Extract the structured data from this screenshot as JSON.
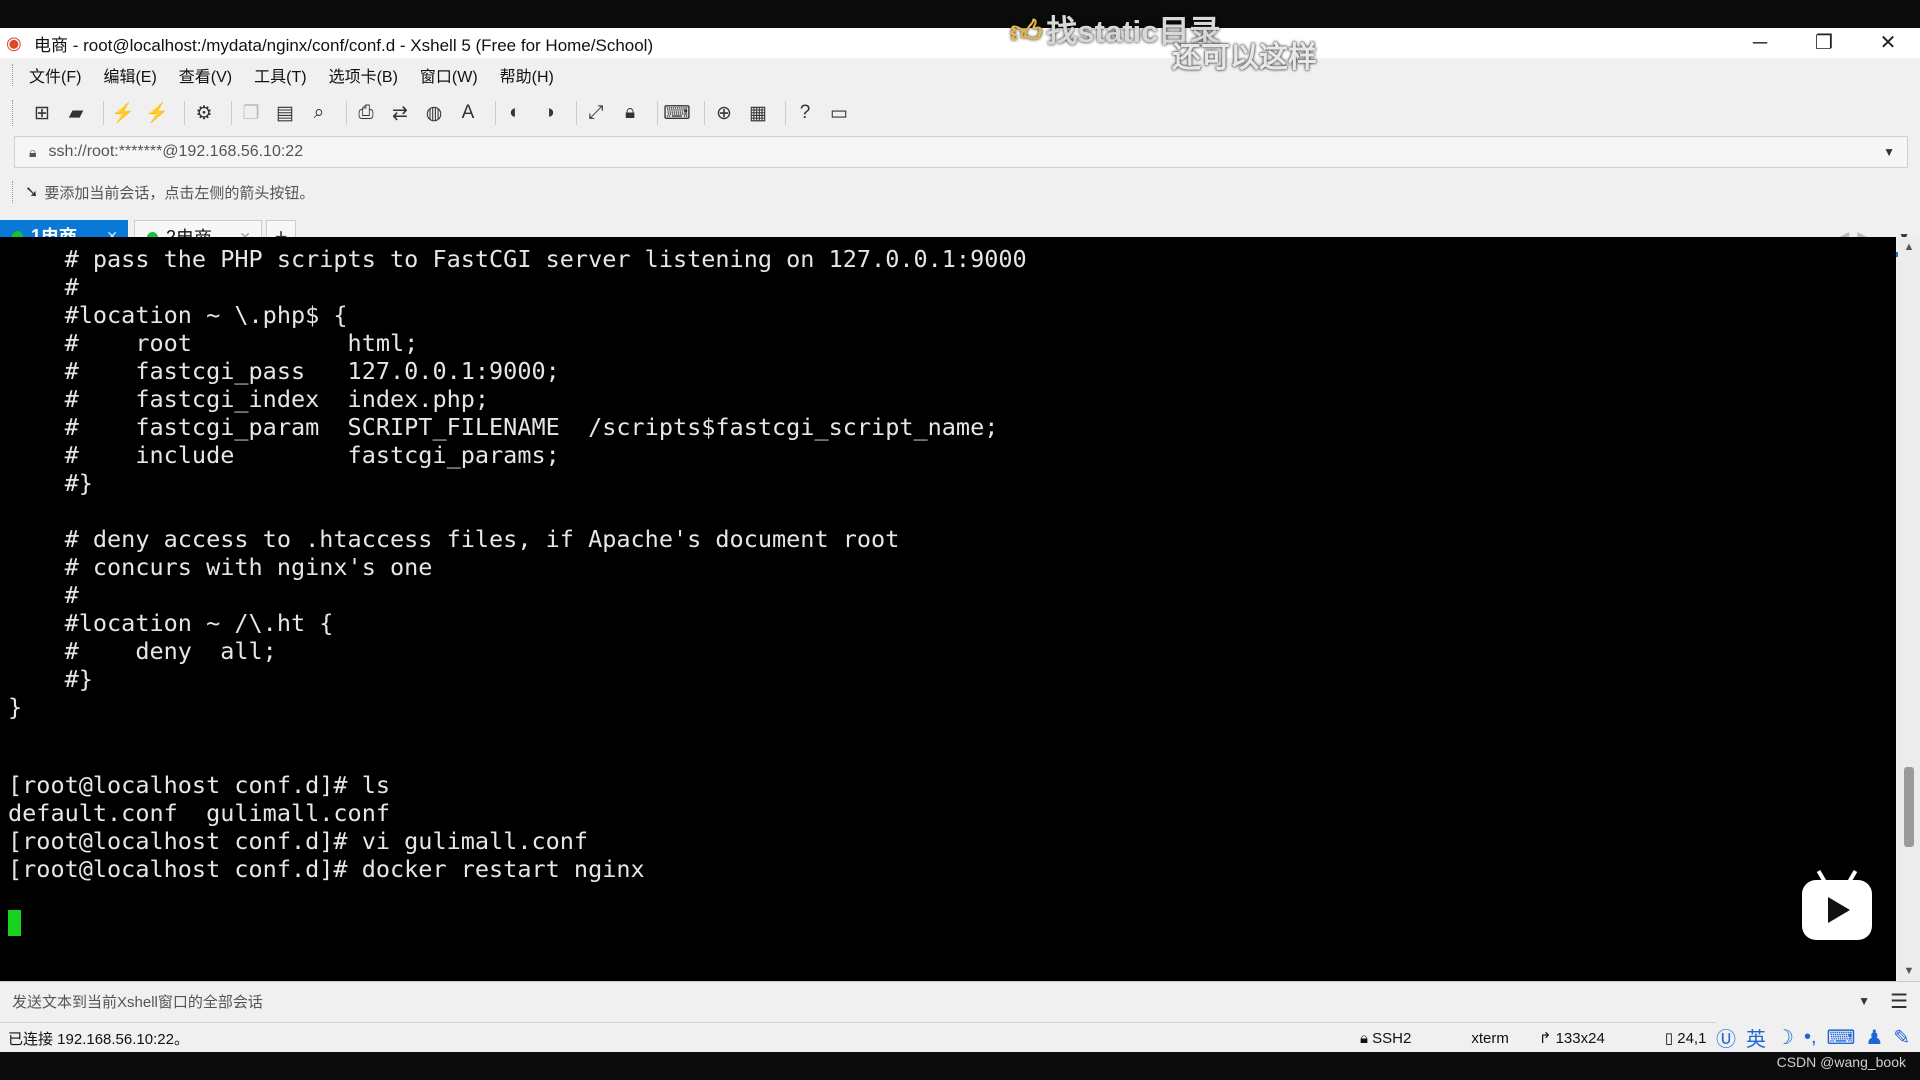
{
  "video_overlay": {
    "thumb_icon": "thumbs-up",
    "top_text": "找static目录",
    "sub_text": "还可以这样"
  },
  "window": {
    "title": "电商 - root@localhost:/mydata/nginx/conf/conf.d - Xshell 5 (Free for Home/School)",
    "minimize": "─",
    "maximize": "❐",
    "close": "✕"
  },
  "menu": [
    "文件(F)",
    "编辑(E)",
    "查看(V)",
    "工具(T)",
    "选项卡(B)",
    "窗口(W)",
    "帮助(H)"
  ],
  "address": {
    "value": "ssh://root:*******@192.168.56.10:22"
  },
  "hint": {
    "text": "要添加当前会话，点击左侧的箭头按钮。"
  },
  "tabs": [
    {
      "number": "1",
      "label": "电商",
      "active": true,
      "status_color": "#19c137"
    },
    {
      "number": "2",
      "label": "电商",
      "active": false,
      "status_color": "#19c137"
    }
  ],
  "terminal": {
    "lines": [
      "    # pass the PHP scripts to FastCGI server listening on 127.0.0.1:9000",
      "    #",
      "    #location ~ \\.php$ {",
      "    #    root           html;",
      "    #    fastcgi_pass   127.0.0.1:9000;",
      "    #    fastcgi_index  index.php;",
      "    #    fastcgi_param  SCRIPT_FILENAME  /scripts$fastcgi_script_name;",
      "    #    include        fastcgi_params;",
      "    #}",
      "",
      "    # deny access to .htaccess files, if Apache's document root",
      "    # concurs with nginx's one",
      "    #",
      "    #location ~ /\\.ht {",
      "    #    deny  all;",
      "    #}",
      "}",
      "",
      "[root@localhost conf.d]# ls",
      "default.conf  gulimall.conf",
      "[root@localhost conf.d]# vi gulimall.conf",
      "[root@localhost conf.d]# docker restart nginx"
    ],
    "cursor_color": "#19d11f"
  },
  "send_bar": {
    "placeholder": "发送文本到当前Xshell窗口的全部会话"
  },
  "status": {
    "connection": "已连接 192.168.56.10:22。",
    "protocol": "SSH2",
    "terminal_type": "xterm",
    "size": "133x24",
    "position": "24,1"
  },
  "ime": {
    "lang": "英"
  },
  "watermark": "CSDN @wang_book",
  "accent_color": "#0a78d7"
}
